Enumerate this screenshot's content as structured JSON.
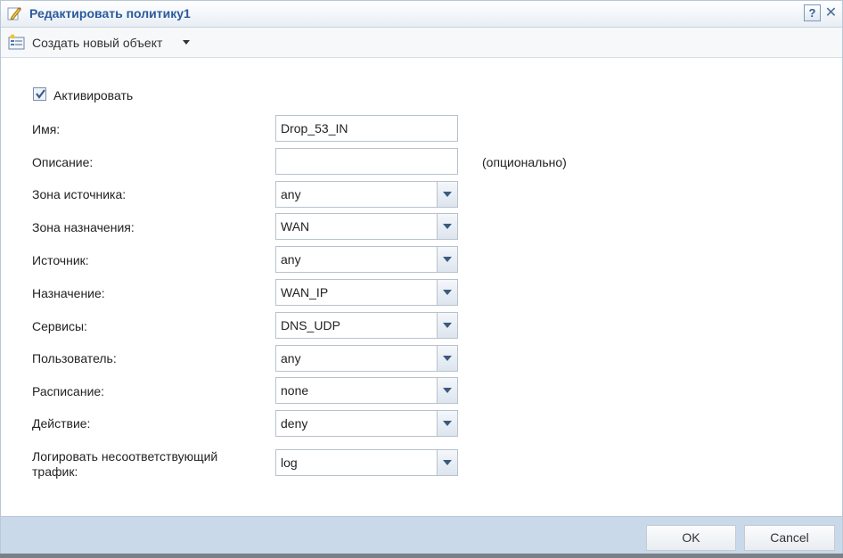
{
  "window": {
    "title": "Редактировать политику1",
    "help_label": "?",
    "close_label": "✕"
  },
  "toolbar": {
    "create_label": "Создать новый объект"
  },
  "form": {
    "activate_label": "Активировать",
    "activate_checked": true,
    "name": {
      "label": "Имя:",
      "value": "Drop_53_IN"
    },
    "description": {
      "label": "Описание:",
      "value": "",
      "hint": "(опционально)"
    },
    "source_zone": {
      "label": "Зона источника:",
      "value": "any"
    },
    "dest_zone": {
      "label": "Зона назначения:",
      "value": "WAN"
    },
    "source": {
      "label": "Источник:",
      "value": "any"
    },
    "destination": {
      "label": "Назначение:",
      "value": "WAN_IP"
    },
    "services": {
      "label": "Сервисы:",
      "value": "DNS_UDP"
    },
    "user": {
      "label": "Пользователь:",
      "value": "any"
    },
    "schedule": {
      "label": "Расписание:",
      "value": "none"
    },
    "action": {
      "label": "Действие:",
      "value": "deny"
    },
    "log": {
      "label_line1": "Логировать несоответствующий",
      "label_line2": "трафик:",
      "value": "log"
    }
  },
  "footer": {
    "ok_label": "OK",
    "cancel_label": "Cancel"
  },
  "colors": {
    "title": "#2a5a9c",
    "footer": "#c9d9ea"
  }
}
